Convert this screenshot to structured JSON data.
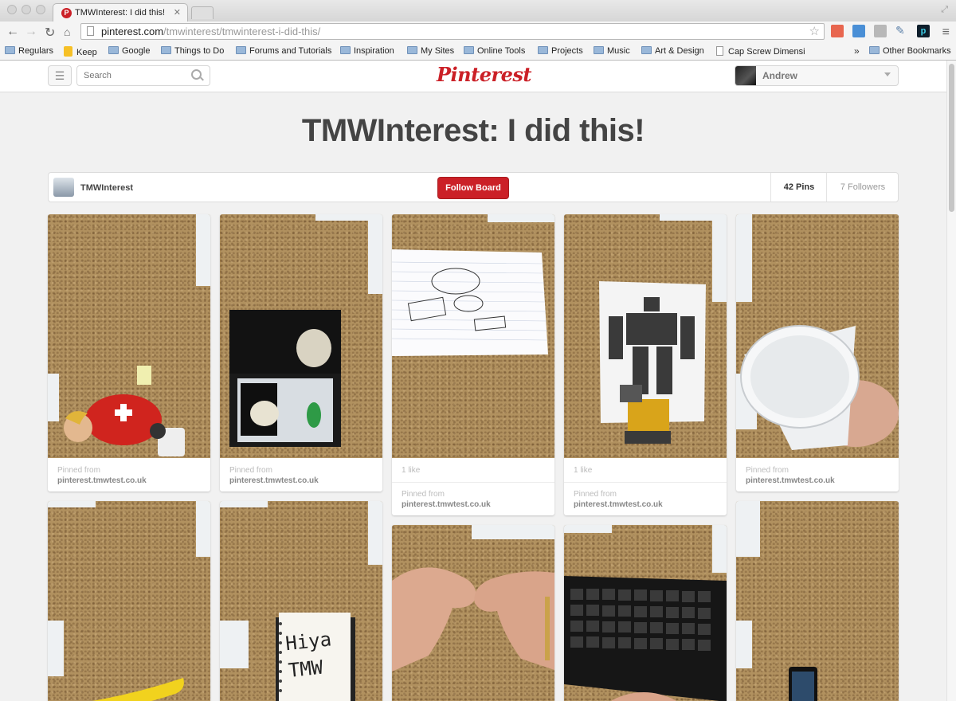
{
  "browser": {
    "tab_title": "TMWInterest: I did this!",
    "url_domain": "pinterest.com",
    "url_path": "/tmwinterest/tmwinterest-i-did-this/",
    "bookmarks": [
      "Regulars",
      "Keep",
      "Google",
      "Things to Do",
      "Forums and Tutorials",
      "Inspiration",
      "My Sites",
      "Online Tools",
      "Projects",
      "Music",
      "Art & Design",
      "Cap Screw Dimensio"
    ],
    "other_bookmarks": "Other Bookmarks",
    "overflow": "»"
  },
  "header": {
    "search_placeholder": "Search",
    "logo": "Pinterest",
    "user_name": "Andrew"
  },
  "board": {
    "title": "TMWInterest: I did this!",
    "owner": "TMWInterest",
    "follow_label": "Follow Board",
    "pins_count": "42 Pins",
    "followers_count": "7 Followers"
  },
  "pins": [
    {
      "image": "doll on corkboard",
      "likes": "",
      "pinned_from": "Pinned from",
      "source": "pinterest.tmwtest.co.uk"
    },
    {
      "image": "christmas decoration box",
      "likes": "",
      "pinned_from": "Pinned from",
      "source": "pinterest.tmwtest.co.uk"
    },
    {
      "image": "sketch on paper",
      "likes": "1 like",
      "pinned_from": "Pinned from",
      "source": "pinterest.tmwtest.co.uk"
    },
    {
      "image": "robot figure",
      "likes": "1 like",
      "pinned_from": "Pinned from",
      "source": "pinterest.tmwtest.co.uk"
    },
    {
      "image": "plastic cup",
      "likes": "",
      "pinned_from": "Pinned from",
      "source": "pinterest.tmwtest.co.uk"
    },
    {
      "image": "banana"
    },
    {
      "image": "notebook",
      "note_text": "Hiya TMW"
    },
    {
      "image": "hands"
    },
    {
      "image": "keyboard"
    },
    {
      "image": "phone"
    }
  ],
  "colors": {
    "pinterest_red": "#cb2027",
    "cork": "#b1915f",
    "page_bg": "#f1f1f1"
  }
}
